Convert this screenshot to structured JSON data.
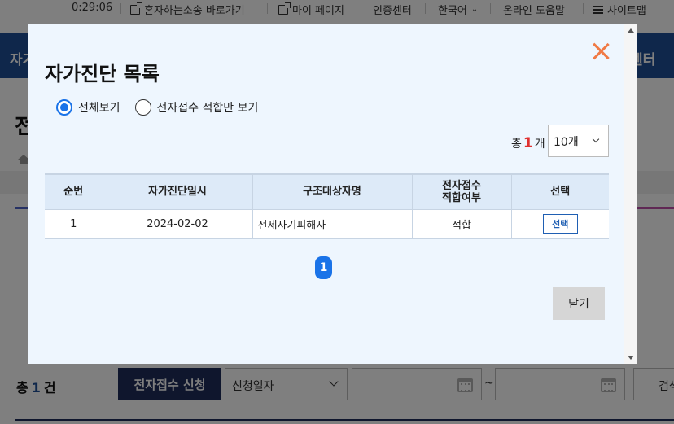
{
  "topbar": {
    "time": "0:29:06",
    "links": [
      "혼자하는소송 바로가기",
      "마이 페이지",
      "인증센터",
      "한국어",
      "온라인 도움말",
      "사이트맵"
    ]
  },
  "nav": {
    "left_fragment": "자가",
    "right_fragment": "센터"
  },
  "page": {
    "title_fragment": "전"
  },
  "list_bar": {
    "total_prefix": "총",
    "total_count": "1",
    "total_suffix": "건",
    "apply_button": "전자접수 신청",
    "date_type_select": "신청일자",
    "range_separator": "~",
    "search_fragment": "검색"
  },
  "modal": {
    "title": "자가진단 목록",
    "radio_options": [
      {
        "label": "전체보기",
        "checked": true
      },
      {
        "label": "전자접수 적합만 보기",
        "checked": false
      }
    ],
    "count_prefix": "총",
    "count_value": "1",
    "count_suffix": "개",
    "page_size": "10개",
    "table": {
      "headers": [
        "순번",
        "자가진단일시",
        "구조대상자명",
        "전자접수\n적합여부",
        "선택"
      ],
      "rows": [
        {
          "no": "1",
          "date": "2024-02-02",
          "name": "전세사기피해자",
          "fit": "적합",
          "select_label": "선택"
        }
      ]
    },
    "current_page": "1",
    "close_button": "닫기"
  },
  "colors": {
    "navy": "#1f2d5a",
    "nav_blue": "#1f4e97",
    "accent_blue": "#1a73e8",
    "close_orange": "#f07a45",
    "count_red": "#e0302f",
    "modal_bg": "#eef6fe"
  }
}
